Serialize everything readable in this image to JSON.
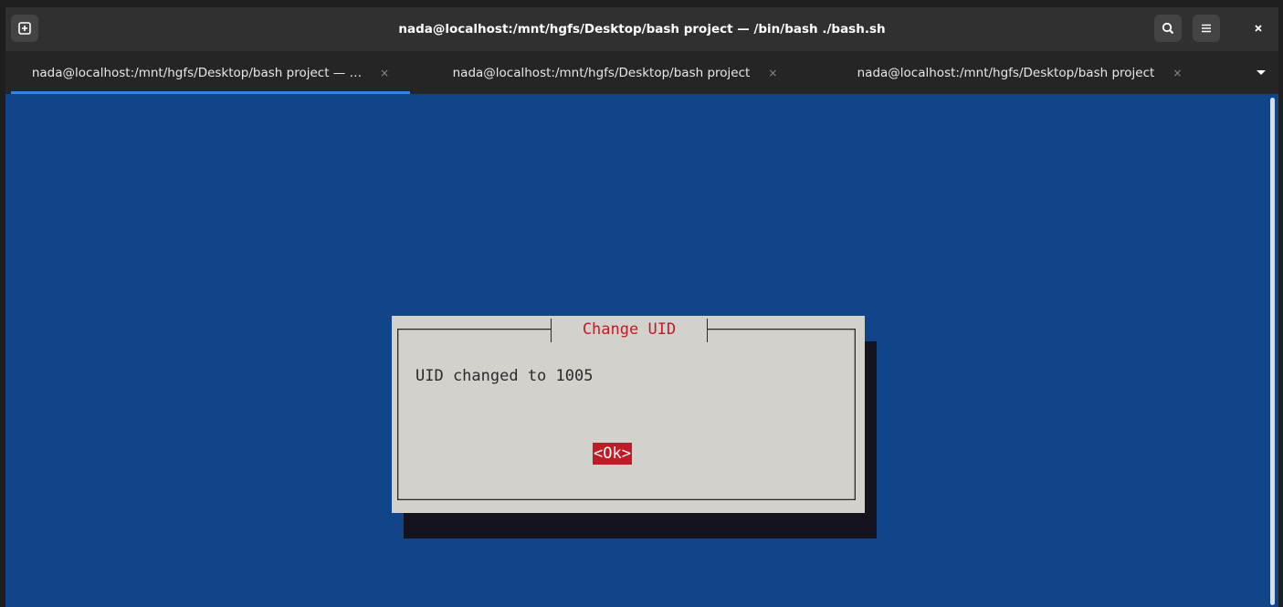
{
  "window": {
    "title": "nada@localhost:/mnt/hgfs/Desktop/bash project — /bin/bash ./bash.sh",
    "icons": [
      "new-tab-icon",
      "search-icon",
      "menu-icon",
      "close-icon"
    ],
    "tabs_menu_icon": "tabs-dropdown-icon"
  },
  "tabs": [
    {
      "label": "nada@localhost:/mnt/hgfs/Desktop/bash project — …",
      "close": "×",
      "active": true
    },
    {
      "label": "nada@localhost:/mnt/hgfs/Desktop/bash project",
      "close": "×",
      "active": false
    },
    {
      "label": "nada@localhost:/mnt/hgfs/Desktop/bash project",
      "close": "×",
      "active": false
    }
  ],
  "dialog": {
    "title": "Change UID",
    "message": "UID changed to 1005",
    "ok_label": "<Ok>"
  },
  "colors": {
    "terminal_background": "#12448a",
    "dialog_background": "#d3d1cb",
    "dialog_accent": "#c01c28",
    "tab_indicator": "#3584e4"
  }
}
